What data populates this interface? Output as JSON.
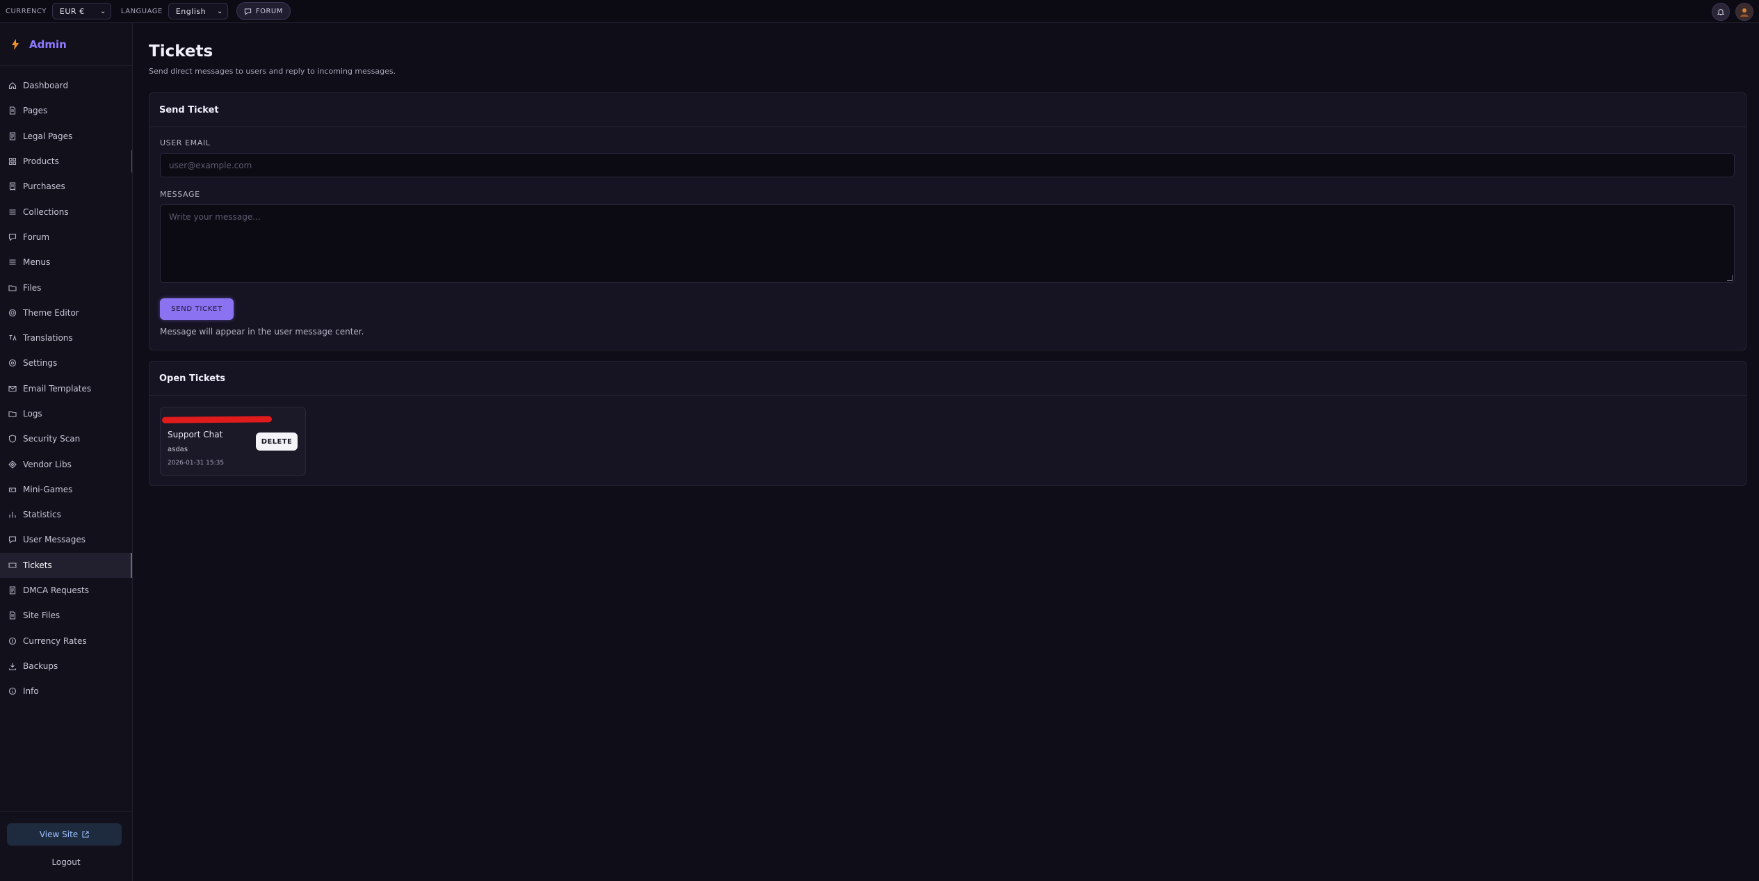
{
  "topbar": {
    "currency_label": "CURRENCY",
    "currency_value": "EUR €",
    "language_label": "LANGUAGE",
    "language_value": "English",
    "forum_label": "FORUM"
  },
  "sidebar": {
    "brand": "Admin",
    "items": [
      {
        "label": "Dashboard",
        "icon": "home-icon"
      },
      {
        "label": "Pages",
        "icon": "file-icon"
      },
      {
        "label": "Legal Pages",
        "icon": "document-icon"
      },
      {
        "label": "Products",
        "icon": "grid-icon"
      },
      {
        "label": "Purchases",
        "icon": "receipt-icon"
      },
      {
        "label": "Collections",
        "icon": "list-icon"
      },
      {
        "label": "Forum",
        "icon": "chat-icon"
      },
      {
        "label": "Menus",
        "icon": "menu-icon"
      },
      {
        "label": "Files",
        "icon": "folder-icon"
      },
      {
        "label": "Theme Editor",
        "icon": "gear-icon"
      },
      {
        "label": "Translations",
        "icon": "translate-icon"
      },
      {
        "label": "Settings",
        "icon": "settings-icon"
      },
      {
        "label": "Email Templates",
        "icon": "mail-icon"
      },
      {
        "label": "Logs",
        "icon": "folder-icon"
      },
      {
        "label": "Security Scan",
        "icon": "shield-icon"
      },
      {
        "label": "Vendor Libs",
        "icon": "diamond-icon"
      },
      {
        "label": "Mini-Games",
        "icon": "gamepad-icon"
      },
      {
        "label": "Statistics",
        "icon": "bar-chart-icon"
      },
      {
        "label": "User Messages",
        "icon": "message-icon"
      },
      {
        "label": "Tickets",
        "icon": "ticket-icon"
      },
      {
        "label": "DMCA Requests",
        "icon": "document-icon"
      },
      {
        "label": "Site Files",
        "icon": "file-icon"
      },
      {
        "label": "Currency Rates",
        "icon": "coin-icon"
      },
      {
        "label": "Backups",
        "icon": "download-icon"
      },
      {
        "label": "Info",
        "icon": "info-icon"
      }
    ],
    "active": "Tickets",
    "view_site": "View Site",
    "logout": "Logout"
  },
  "page": {
    "title": "Tickets",
    "subtitle": "Send direct messages to users and reply to incoming messages."
  },
  "send_ticket": {
    "heading": "Send Ticket",
    "email_label": "USER EMAIL",
    "email_placeholder": "user@example.com",
    "message_label": "MESSAGE",
    "message_placeholder": "Write your message...",
    "button": "SEND TICKET",
    "hint": "Message will appear in the user message center."
  },
  "open_tickets": {
    "heading": "Open Tickets",
    "tickets": [
      {
        "title": "Support Chat",
        "body": "asdas",
        "date": "2026-01-31 15:35",
        "delete_label": "DELETE"
      }
    ]
  },
  "colors": {
    "accent": "#8a72f0",
    "brand": "#8d7bff",
    "redaction": "#e01b1b"
  }
}
